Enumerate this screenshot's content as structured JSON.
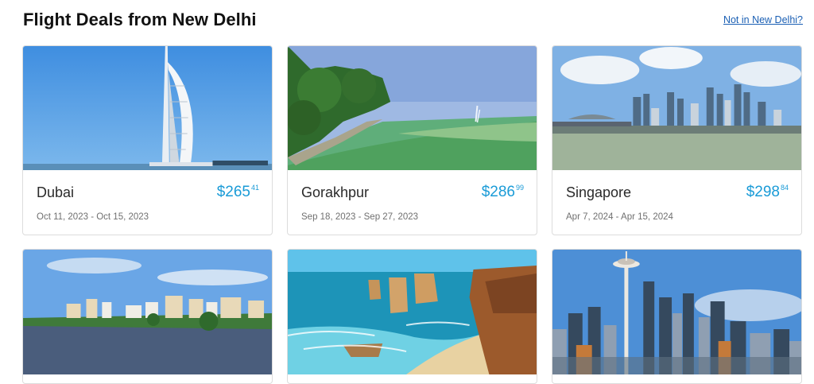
{
  "header": {
    "title": "Flight Deals from New Delhi",
    "location_link": "Not in New Delhi?"
  },
  "colors": {
    "price": "#1a9bd7",
    "link": "#1a5fb4"
  },
  "deals": [
    {
      "city": "Dubai",
      "price_main": "$265",
      "price_cents": "41",
      "dates": "Oct 11, 2023 - Oct 15, 2023",
      "image": "burj-al-arab-photo"
    },
    {
      "city": "Gorakhpur",
      "price_main": "$286",
      "price_cents": "99",
      "dates": "Sep 18, 2023 - Sep 27, 2023",
      "image": "green-lake-photo"
    },
    {
      "city": "Singapore",
      "price_main": "$298",
      "price_cents": "84",
      "dates": "Apr 7, 2024 - Apr 15, 2024",
      "image": "singapore-skyline-photo"
    },
    {
      "image": "riverside-city-photo"
    },
    {
      "image": "twelve-apostles-coast-photo"
    },
    {
      "image": "seattle-skyline-photo"
    }
  ]
}
